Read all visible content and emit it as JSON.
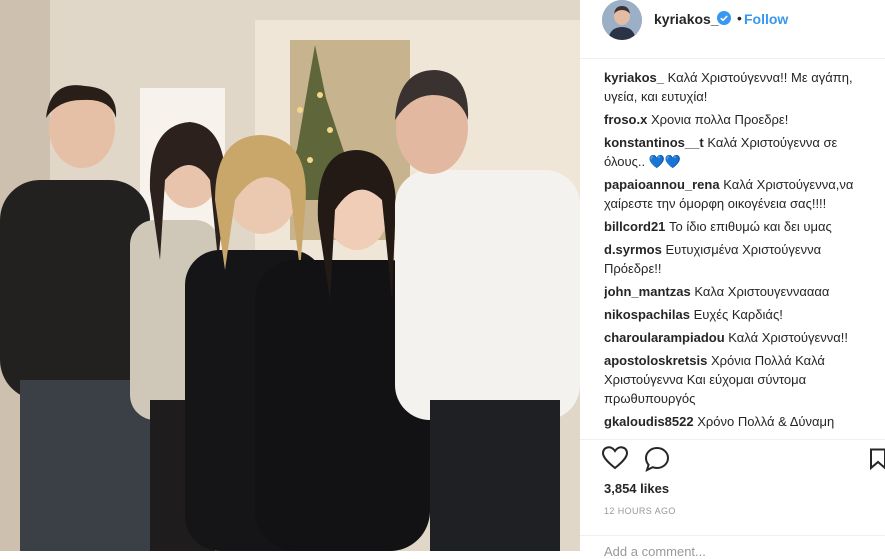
{
  "post": {
    "username": "kyriakos_",
    "follow_label": "Follow",
    "separator": "•",
    "likes": "3,854 likes",
    "time": "12 HOURS AGO",
    "add_comment_placeholder": "Add a comment..."
  },
  "comments": [
    {
      "user": "kyriakos_",
      "text": "Καλά Χριστούγεννα!! Με αγάπη, υγεία, και ευτυχία!"
    },
    {
      "user": "froso.x",
      "text": "Χρονια πολλα Προεδρε!"
    },
    {
      "user": "konstantinos__t",
      "text": "Καλά Χριστούγεννα σε όλους.. 💙💙"
    },
    {
      "user": "papaioannou_rena",
      "text": "Καλά Χριστούγεννα,να χαίρεστε την όμορφη οικογένεια σας!!!!"
    },
    {
      "user": "billcord21",
      "text": "Το ίδιο επιθυμώ και δει υμας"
    },
    {
      "user": "d.syrmos",
      "text": "Ευτυχισμένα Χριστούγεννα Πρόεδρε!!"
    },
    {
      "user": "john_mantzas",
      "text": "Καλα Χριστουγενναααα"
    },
    {
      "user": "nikospachilas",
      "text": "Ευχές Καρδιάς!"
    },
    {
      "user": "charoularampiadou",
      "text": "Καλά Χριστούγεννα!!"
    },
    {
      "user": "apostoloskretsis",
      "text": "Χρόνια Πολλά Καλά Χριστούγεννα Και εύχομαι σύντομα πρωθυπουργός"
    },
    {
      "user": "gkaloudis8522",
      "text": "Χρόνο Πολλά & Δύναμη"
    }
  ],
  "icons": {
    "verified": "verified-badge-icon",
    "like": "heart-icon",
    "comment": "comment-bubble-icon",
    "save": "bookmark-icon"
  },
  "colors": {
    "link_blue": "#3897f0",
    "verified_blue": "#3897f0",
    "muted": "#999999",
    "text": "#262626"
  }
}
